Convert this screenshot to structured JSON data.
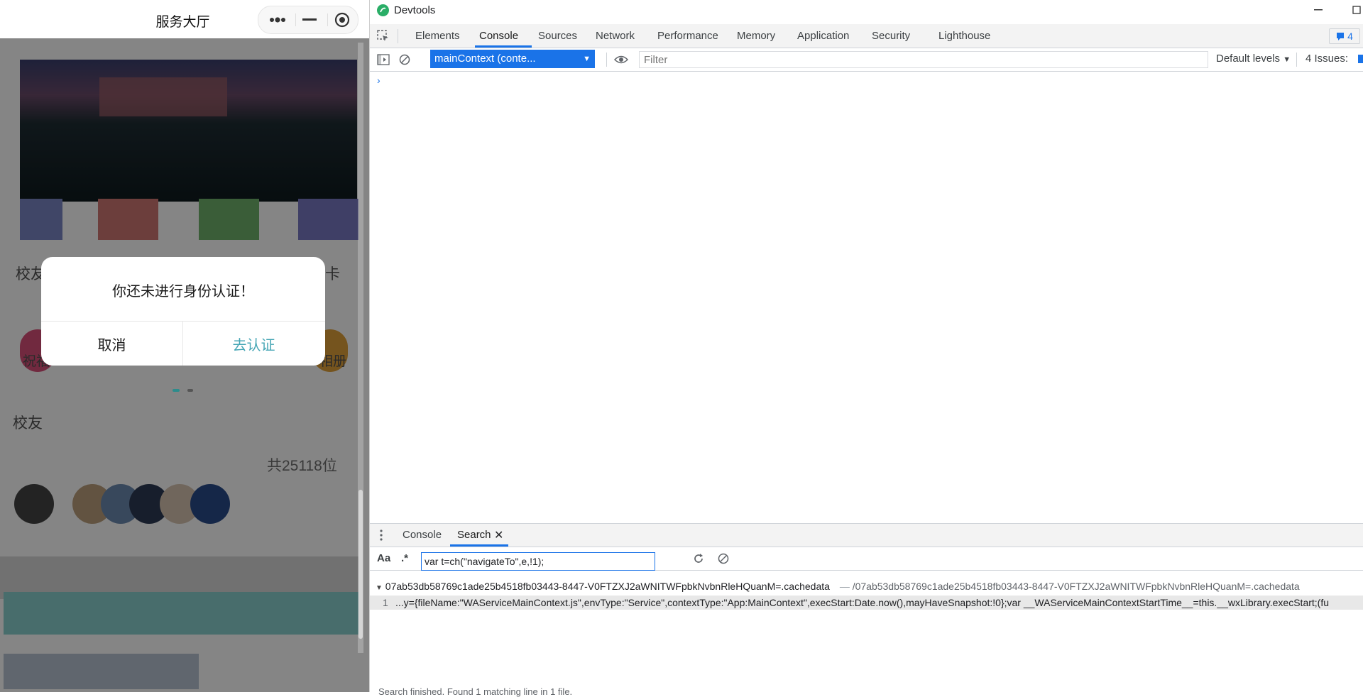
{
  "phone": {
    "title": "服务大厅",
    "capsule": {
      "more_icon": "more-dots-icon",
      "minimize_icon": "minimize-icon",
      "close_icon": "record-circle-icon"
    },
    "background_labels": {
      "alumni_partial": "校友",
      "card_partial": "卡",
      "wish_partial": "祝福",
      "album_partial": "相册",
      "alumni_section": "校友",
      "alumni_count": "共25118位"
    },
    "dialog": {
      "message": "你还未进行身份认证！",
      "cancel": "取消",
      "confirm": "去认证"
    },
    "colors": {
      "confirm": "#46a6b5",
      "overlay": "rgba(0,0,0,0.48)"
    }
  },
  "devtools": {
    "window_title": "Devtools",
    "tabs": [
      "Elements",
      "Console",
      "Sources",
      "Network",
      "Performance",
      "Memory",
      "Application",
      "Security",
      "Lighthouse"
    ],
    "active_tab": "Console",
    "messages_badge": "4",
    "toolbar": {
      "context": "mainContext (conte...",
      "filter_placeholder": "Filter",
      "levels": "Default levels",
      "issues": "4 Issues:"
    },
    "prompt": "›",
    "drawer": {
      "tabs": [
        "Console",
        "Search"
      ],
      "active_tab": "Search",
      "case_label": "Aa",
      "regex_label": ".*",
      "query": "var t=ch(\"navigateTo\",e,!1);",
      "result_file": "07ab53db58769c1ade25b4518fb03443-8447-V0FTZXJ2aWNITWFpbkNvbnRleHQuanM=.cachedata",
      "result_path": "/07ab53db58769c1ade25b4518fb03443-8447-V0FTZXJ2aWNITWFpbkNvbnRleHQuanM=.cachedata",
      "line_no": "1",
      "line_text": "...y={fileName:\"WAServiceMainContext.js\",envType:\"Service\",contextType:\"App:MainContext\",execStart:Date.now(),mayHaveSnapshot:!0};var __WAServiceMainContextStartTime__=this.__wxLibrary.execStart;(fu",
      "status": "Search finished. Found 1 matching line in 1 file."
    }
  }
}
